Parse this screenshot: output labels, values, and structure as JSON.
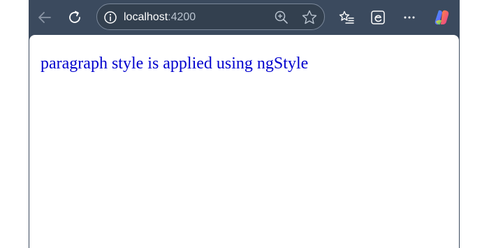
{
  "browser": {
    "address_bar": {
      "host": "localhost",
      "port": ":4200"
    },
    "icons": {
      "back": "back-arrow-icon",
      "refresh": "refresh-icon",
      "info": "info-icon",
      "zoom": "zoom-in-icon",
      "favorite": "star-icon",
      "favorites_list": "favorites-list-icon",
      "browser_essentials": "edge-icon",
      "more": "more-icon",
      "copilot": "copilot-icon"
    }
  },
  "page": {
    "paragraph": "paragraph style is applied using ngStyle",
    "paragraph_color": "#0000cd"
  },
  "colors": {
    "toolbar": "#3b4a5e",
    "content_bg": "#ffffff"
  }
}
